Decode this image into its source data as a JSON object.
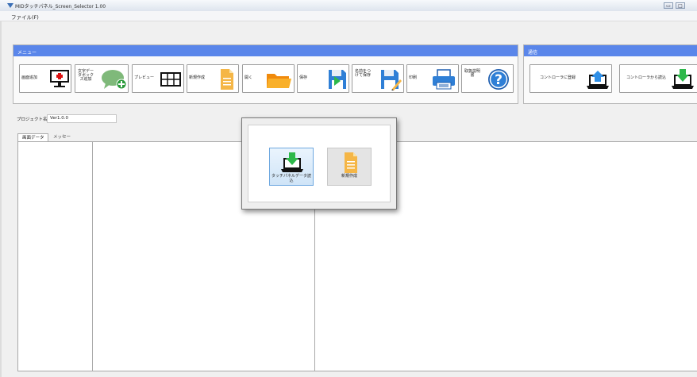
{
  "window": {
    "title": "MIDタッチパネル_Screen_Selector 1.00",
    "min_glyph": "▭",
    "max_glyph": "□"
  },
  "menubar": {
    "file": "ファイル(F)"
  },
  "menu_group": {
    "title": "メニュー",
    "buttons": [
      {
        "label": "画面追加",
        "icon": "monitor-plus-icon"
      },
      {
        "label": "文字データボックス追加",
        "icon": "speech-bubble-plus-icon"
      },
      {
        "label": "プレビュー",
        "icon": "grid-preview-icon"
      },
      {
        "label": "新規作成",
        "icon": "new-document-icon"
      },
      {
        "label": "開く",
        "icon": "folder-icon"
      },
      {
        "label": "保存",
        "icon": "save-icon"
      },
      {
        "label": "名前をつけて保存",
        "icon": "save-as-icon"
      },
      {
        "label": "印刷",
        "icon": "printer-icon"
      },
      {
        "label": "取扱説明書",
        "icon": "help-icon"
      }
    ]
  },
  "comm_group": {
    "title": "通信",
    "buttons": [
      {
        "label": "コントローラに登録",
        "icon": "upload-laptop-icon"
      },
      {
        "label": "コントローラから読込",
        "icon": "download-laptop-icon"
      }
    ]
  },
  "project": {
    "label": "プロジェクト名",
    "value": "Ver1.0.0"
  },
  "tabs": [
    {
      "label": "画面データ"
    },
    {
      "label": "メッセージ"
    }
  ],
  "dialog": {
    "buttons": [
      {
        "label": "タッチパネルデータ読込",
        "icon": "download-laptop-icon"
      },
      {
        "label": "新規作成",
        "icon": "new-document-icon"
      }
    ]
  },
  "colors": {
    "group_header": "#5a86ea",
    "accent_green": "#2db84a",
    "accent_blue": "#2f7fd6",
    "doc_orange": "#f5b646",
    "folder_orange": "#f7a61c"
  }
}
